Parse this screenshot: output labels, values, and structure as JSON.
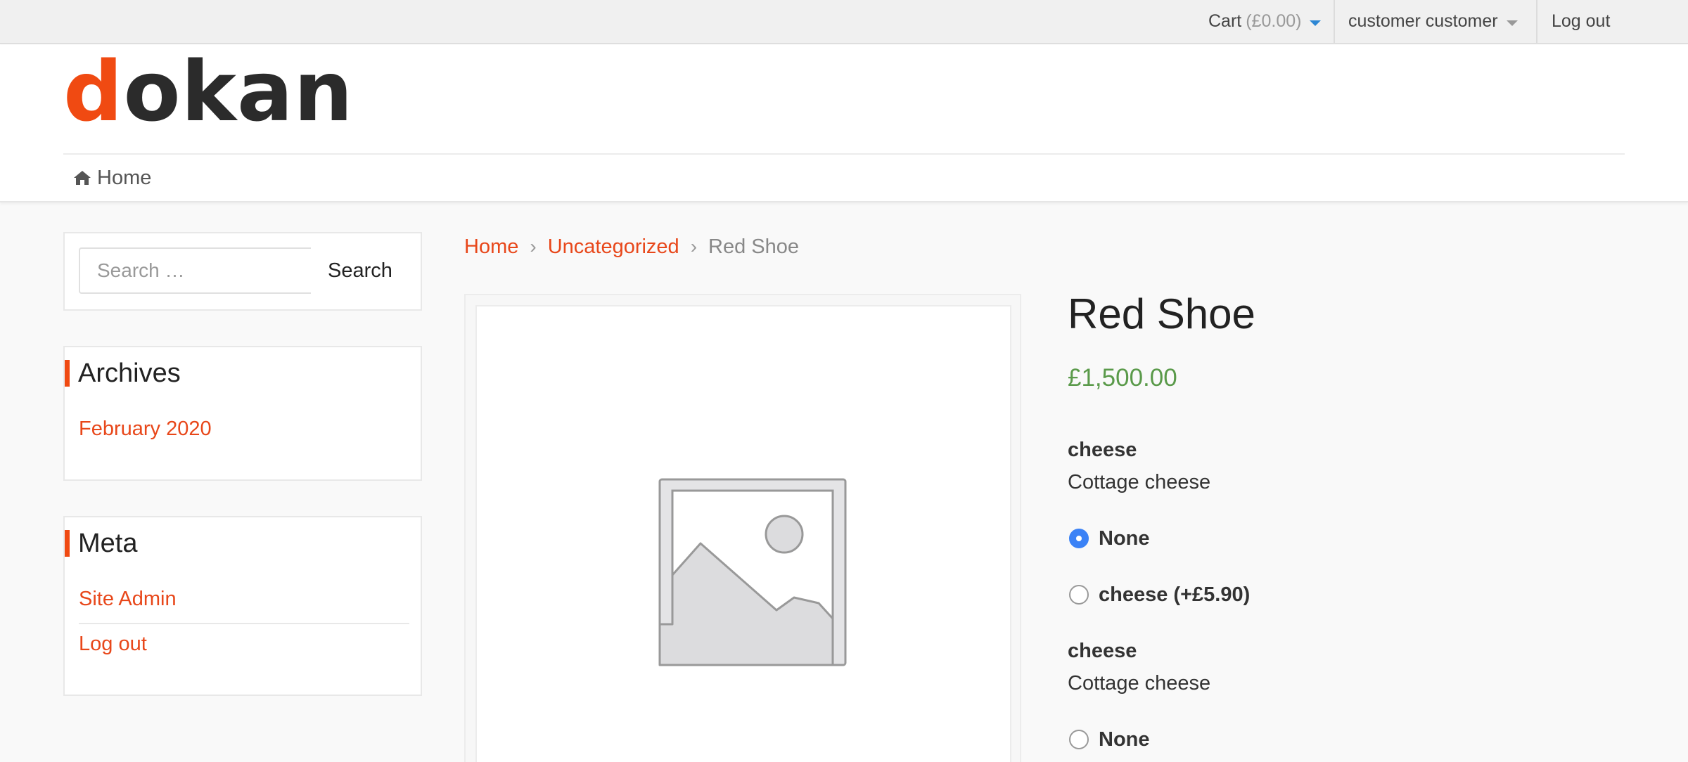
{
  "topbar": {
    "cart_label": "Cart",
    "cart_amount": "(£0.00)",
    "user_label": "customer customer",
    "logout_label": "Log out"
  },
  "header": {
    "logo_first": "d",
    "logo_rest": "okan",
    "nav_home": "Home"
  },
  "sidebar": {
    "search_placeholder": "Search …",
    "search_button": "Search",
    "archives_title": "Archives",
    "archives_items": [
      "February 2020"
    ],
    "meta_title": "Meta",
    "meta_items": [
      "Site Admin",
      "Log out"
    ]
  },
  "breadcrumb": {
    "home": "Home",
    "category": "Uncategorized",
    "current": "Red Shoe"
  },
  "product": {
    "title": "Red Shoe",
    "price": "£1,500.00",
    "addons": [
      {
        "title": "cheese",
        "description": "Cottage cheese",
        "options": [
          {
            "label": "None",
            "checked": true
          },
          {
            "label": "cheese (+£5.90)",
            "checked": false
          }
        ]
      },
      {
        "title": "cheese",
        "description": "Cottage cheese",
        "options": [
          {
            "label": "None",
            "checked": false
          }
        ]
      }
    ]
  },
  "colors": {
    "accent": "#f04a12",
    "link": "#e8471a",
    "price": "#5a9a4a",
    "radio_checked": "#3b82f6"
  }
}
